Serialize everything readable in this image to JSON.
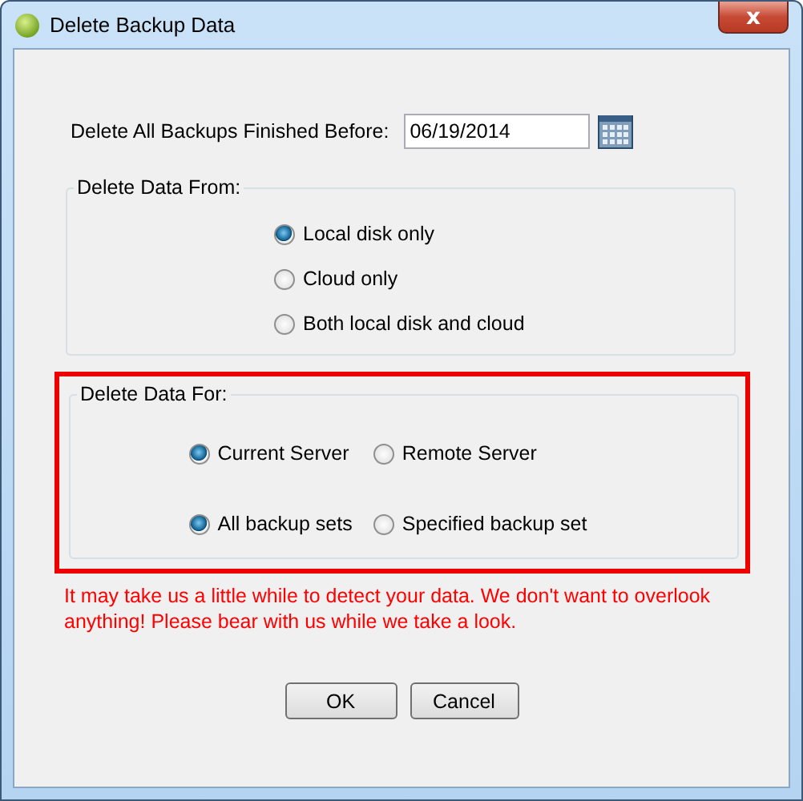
{
  "window": {
    "title": "Delete Backup Data",
    "close": "x"
  },
  "date_field": {
    "label": "Delete All Backups Finished Before:",
    "value": "06/19/2014"
  },
  "delete_from": {
    "legend": "Delete Data From:",
    "options": [
      {
        "label": "Local disk only",
        "selected": true
      },
      {
        "label": "Cloud only",
        "selected": false
      },
      {
        "label": "Both local disk and cloud",
        "selected": false
      }
    ]
  },
  "delete_for": {
    "legend": "Delete Data For:",
    "highlighted": true,
    "rows": [
      {
        "options": [
          {
            "label": "Current Server",
            "selected": true
          },
          {
            "label": "Remote Server",
            "selected": false
          }
        ]
      },
      {
        "options": [
          {
            "label": "All backup sets",
            "selected": true
          },
          {
            "label": "Specified backup set",
            "selected": false
          }
        ]
      }
    ]
  },
  "message": "It may take us a little while to detect your data. We don't want to overlook anything! Please bear with us while we take a look.",
  "buttons": [
    "OK",
    "Cancel"
  ]
}
